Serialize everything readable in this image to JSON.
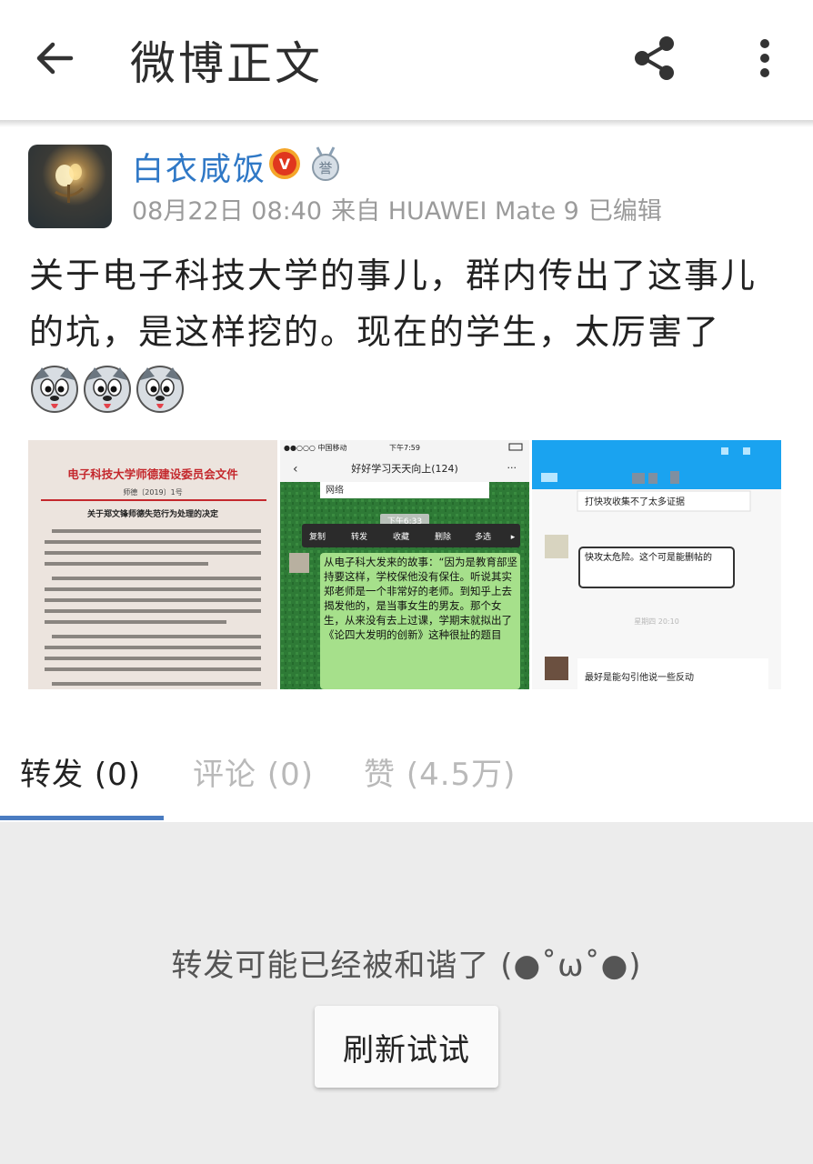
{
  "header": {
    "title": "微博正文",
    "back_icon": "arrow-left-icon",
    "share_icon": "share-icon",
    "more_icon": "more-vertical-icon"
  },
  "post": {
    "author": {
      "name": "白衣咸饭",
      "verified_badge": "V",
      "medal_badge": "medal-icon"
    },
    "meta": {
      "time": "08月22日 08:40",
      "source": "来自 HUAWEI Mate 9",
      "edited": "已编辑"
    },
    "text": "关于电子科技大学的事儿，群内传出了这事儿的坑，是这样挖的。现在的学生，太厉害了",
    "emoji_count_icon": "husky-dog-emoji-icon",
    "images": {
      "doc": {
        "title": "电子科技大学师德建设委员会文件",
        "number": "师德〔2019〕1号",
        "subtitle": "关于郑文锋师德失范行为处理的决定"
      },
      "chat": {
        "carrier": "●●○○○ 中国移动",
        "time": "下午7:59",
        "group": "好好学习天天向上(124)",
        "prev_msg": "网络",
        "timestamp": "下午6:33",
        "menu": [
          "复制",
          "转发",
          "收藏",
          "删除",
          "多选"
        ],
        "bubble": "从电子科大发来的故事：“因为是教育部坚持要这样，学校保他没有保住。听说其实郑老师是一个非常好的老师。到知乎上去揭发他的，是当事女生的男友。那个女生，从来没有去上过课，学期末就拟出了《论四大发明的创新》这种很扯的题目"
      },
      "chat2": {
        "msg1": "打快攻收集不了太多证据",
        "msg2": "快攻太危险。这个可是能删帖的",
        "timestamp": "星期四 20:10",
        "msg3": "最好是能勾引他说一些反动"
      }
    }
  },
  "tabs": [
    {
      "label": "转发",
      "count": "(0)"
    },
    {
      "label": "评论",
      "count": "(0)"
    },
    {
      "label": "赞",
      "count": "(4.5万)"
    }
  ],
  "empty": {
    "message": "转发可能已经被和谐了 (●˚ω˚●)",
    "refresh_label": "刷新试试"
  },
  "colors": {
    "link_blue": "#2f78c6",
    "tab_active": "#4a7cc1",
    "empty_bg": "#ececec"
  }
}
